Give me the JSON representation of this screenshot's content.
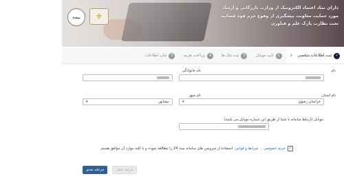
{
  "banner": {
    "lines": [
      "دارای نماد اعتماد الکترونیک از وزارت بازرگانی و ارشاد",
      "مورد حمایت معاونت پیشگیری از وقوع جرم قوه قضائیه",
      "تحت نظارت پارک علم و فناوری"
    ],
    "logo1": "بیمه",
    "logo2_icon": "eagle-emblem"
  },
  "steps": [
    {
      "label": "ثبت اطلاعات شخصی",
      "num": "✓",
      "active": true
    },
    {
      "label": "تایید موبایل",
      "num": "2",
      "active": false
    },
    {
      "label": "ثبت چک ها",
      "num": "3",
      "active": false
    },
    {
      "label": "پرداخت هزینه",
      "num": "4",
      "active": false
    },
    {
      "label": "چاپ اطلاعات",
      "num": "5",
      "active": false
    }
  ],
  "form": {
    "first_name": {
      "label": "نام",
      "value": ""
    },
    "last_name": {
      "label": "نام خانوادگی",
      "value": ""
    },
    "province": {
      "label": "نام استان",
      "value": "خراسان رضوی"
    },
    "city": {
      "label": "نام شهر",
      "value": "نیشابور"
    },
    "mobile": {
      "label": "موبایل (ارتباط سامانه با شما از طریق این شماره موبایل می باشد)",
      "value": ""
    }
  },
  "agreement": {
    "link1": "حریم خصوصی",
    "sep": "،",
    "link2": "شرایط و قوانین",
    "text": "استفاده از سرویس های سامانه سند 24 را مطالعه نموده و با کلیه موارد آن موافق هستم."
  },
  "buttons": {
    "next": "مرحله بعدی",
    "prev": "مرحله قبلی"
  }
}
